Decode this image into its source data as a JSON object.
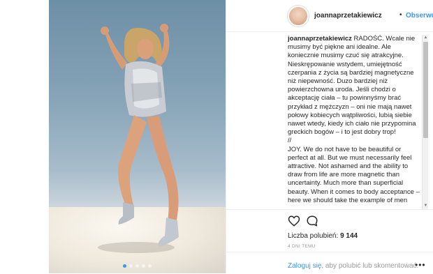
{
  "header": {
    "username": "joannaprzetakiewicz",
    "separator": "•",
    "follow_label": "Obserwuj"
  },
  "caption": {
    "username": "joannaprzetakiewicz",
    "text": " RADOŚĆ. Wcale nie musimy być piękne ani idealne. Ale koniecznie musimy czuć się atrakcyjne. Nieskrępowanie wstydem, umiejętność czerpania z życia są bardziej magnetyczne niż niepewność. Duzo bardziej niż powierzchowna uroda. Jeśli chodzi o akceptację ciała – tu powinnyśmy brać przykład z mężczyzn – oni nie mają nawet połowy kobiecych wątpliwości, lubią siebie nawet wtedy, kiedy ich ciało nie przypomina greckich bogów – i to jest dobry trop!\n//\nJOY. We do not have to be beautiful or perfect at all. But we must necessarily feel attractive. Not ashamed and the ability to draw from life are more magnetic than uncertainty. Much more than superficial beauty. When it comes to body acceptance – here we should take the example of men"
  },
  "actions": {
    "likes_label": "Liczba polubień:",
    "likes_count": "9 144",
    "timestamp": "4 DNI TEMU"
  },
  "login": {
    "login_link": "Zaloguj się",
    "rest_text": ", aby polubić lub skomentować.",
    "more_label": "•••"
  },
  "icons": {
    "like": "heart-icon",
    "comment": "comment-icon",
    "more": "more-options-icon"
  },
  "colors": {
    "accent": "#3897f0",
    "text": "#262626",
    "muted": "#999999"
  },
  "carousel": {
    "total": 5,
    "active": 1
  }
}
